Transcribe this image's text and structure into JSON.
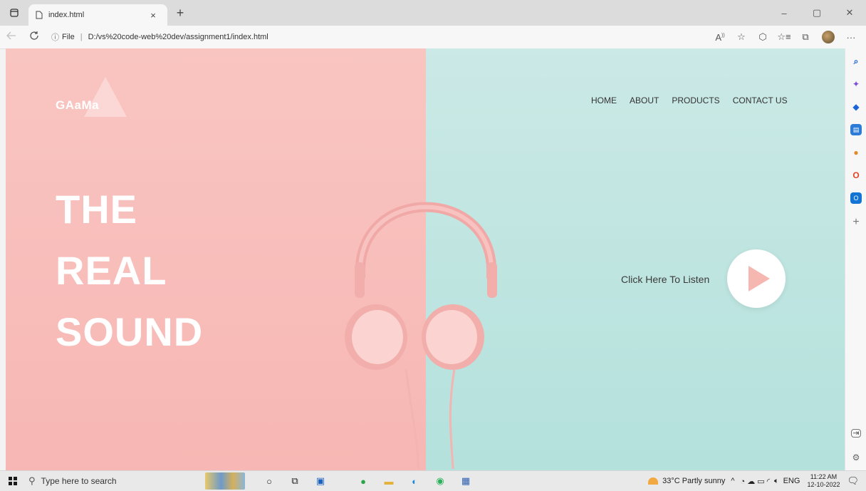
{
  "browser": {
    "tab_title": "index.html",
    "tab_close": "×",
    "new_tab": "+",
    "url_prefix": "File",
    "url": "D:/vs%20code-web%20dev/assignment1/index.html",
    "win_min": "–",
    "win_restore": "▢",
    "win_close": "✕",
    "more": "···"
  },
  "page": {
    "logo": "GAaMa",
    "nav": [
      "HOME",
      "ABOUT",
      "PRODUCTS",
      "CONTACT US"
    ],
    "hero": [
      "THE",
      "REAL",
      "SOUND"
    ],
    "listen_text": "Click Here To Listen",
    "colors": {
      "left_bg": "#f7b7b4",
      "right_bg": "#b4e1dc",
      "play_accent": "#f6b7b1"
    }
  },
  "sidebar": {
    "icons": [
      "search-icon",
      "sparkle-icon",
      "tag-icon",
      "briefcase-icon",
      "people-icon",
      "office-icon",
      "outlook-icon",
      "add-icon"
    ],
    "bottom_icons": [
      "sidebar-toggle-icon",
      "settings-icon"
    ]
  },
  "taskbar": {
    "search_placeholder": "Type here to search",
    "weather": "33°C  Partly sunny",
    "language": "ENG",
    "time": "11:22 AM",
    "date": "12-10-2022"
  }
}
